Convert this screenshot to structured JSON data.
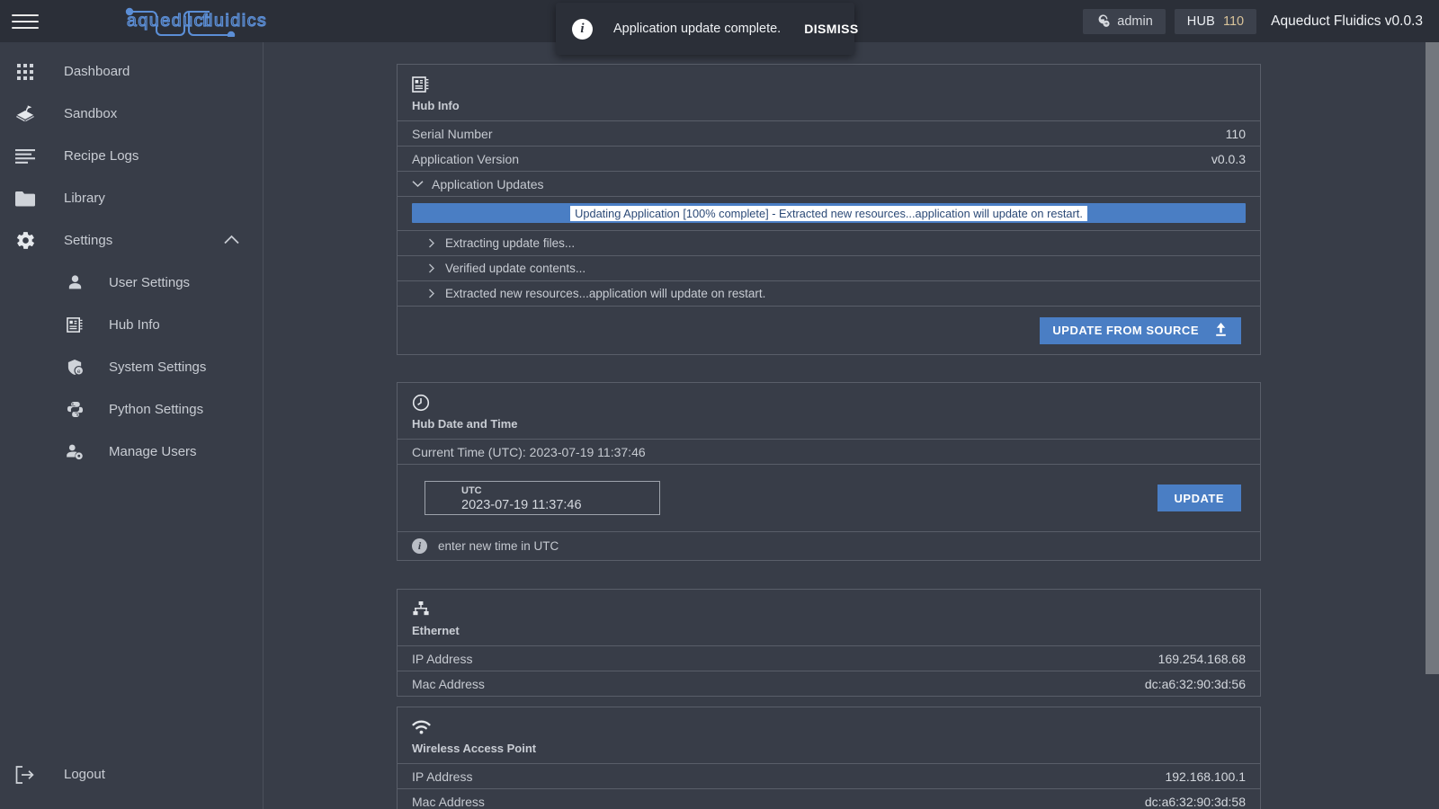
{
  "header": {
    "menu_icon": "hamburger-icon",
    "logo_text": "aqueduct fluidics",
    "user_chip": "admin",
    "hub_label": "HUB",
    "hub_value": "110",
    "app_title": "Aqueduct Fluidics v0.0.3"
  },
  "toast": {
    "icon": "info-icon",
    "message": "Application update complete.",
    "dismiss_label": "DISMISS"
  },
  "sidebar": {
    "items": [
      {
        "label": "Dashboard",
        "icon": "grid-icon"
      },
      {
        "label": "Sandbox",
        "icon": "sandbox-icon"
      },
      {
        "label": "Recipe Logs",
        "icon": "lines-icon"
      },
      {
        "label": "Library",
        "icon": "folder-icon"
      },
      {
        "label": "Settings",
        "icon": "gear-icon",
        "chevron": "chevron-up-icon"
      }
    ],
    "sub_items": [
      {
        "label": "User Settings",
        "icon": "person-icon"
      },
      {
        "label": "Hub Info",
        "icon": "hub-chip-icon"
      },
      {
        "label": "System Settings",
        "icon": "shield-gear-icon"
      },
      {
        "label": "Python Settings",
        "icon": "python-icon"
      },
      {
        "label": "Manage Users",
        "icon": "person-gear-icon"
      }
    ],
    "logout": {
      "label": "Logout",
      "icon": "logout-icon"
    }
  },
  "cards": {
    "hub_info": {
      "icon": "hub-chip-icon",
      "title": "Hub Info",
      "rows": [
        {
          "label": "Serial Number",
          "value": "110"
        },
        {
          "label": "Application Version",
          "value": "v0.0.3"
        }
      ],
      "updates_label": "Application Updates",
      "updates_chevron": "chevron-down-icon",
      "progress_text": "Updating Application [100% complete] - Extracted new resources...application will update on restart.",
      "progress_percent": 100,
      "progress_color": "#4a7ec4",
      "log_lines": [
        "Extracting update files...",
        "Verified update contents...",
        "Extracted new resources...application will update on restart."
      ],
      "button_label": "UPDATE FROM SOURCE",
      "button_icon": "upload-icon"
    },
    "hub_date_time": {
      "icon": "clock-icon",
      "title": "Hub Date and Time",
      "current_time_row": "Current Time (UTC): 2023-07-19 11:37:46",
      "input_label": "UTC",
      "input_value": "2023-07-19 11:37:46",
      "button_label": "UPDATE",
      "hint_icon": "info-icon",
      "hint_text": "enter new time in UTC"
    },
    "ethernet": {
      "icon": "ethernet-icon",
      "title": "Ethernet",
      "rows": [
        {
          "label": "IP Address",
          "value": "169.254.168.68"
        },
        {
          "label": "Mac Address",
          "value": "dc:a6:32:90:3d:56"
        }
      ]
    },
    "wireless": {
      "icon": "wifi-icon",
      "title": "Wireless Access Point",
      "rows": [
        {
          "label": "IP Address",
          "value": "192.168.100.1"
        },
        {
          "label": "Mac Address",
          "value": "dc:a6:32:90:3d:58"
        }
      ]
    }
  }
}
